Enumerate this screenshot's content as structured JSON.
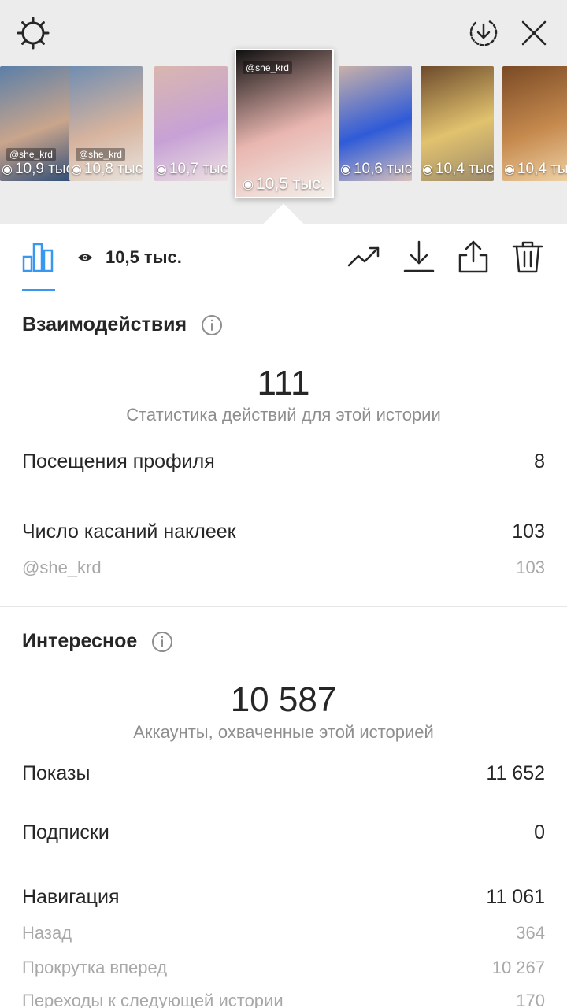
{
  "top_bar": {
    "settings_icon": "gear-icon",
    "download_all_icon": "download-circle-icon",
    "close_icon": "close-icon"
  },
  "thumbnails": [
    {
      "views": "10,9 тыс",
      "handle": "@she_krd",
      "colors": [
        "#5b7fa8",
        "#c9a58c",
        "#2f4d77"
      ]
    },
    {
      "views": "10,8 тыс",
      "handle": "@she_krd",
      "colors": [
        "#6f8db2",
        "#d6b39e",
        "#e9e4de"
      ]
    },
    {
      "views": "10,7 тыс",
      "handle": "",
      "colors": [
        "#d9b7ae",
        "#c7a1d6",
        "#ece2e0"
      ]
    },
    {
      "views": "10,5 тыс.",
      "handle": "@she_krd",
      "colors": [
        "#111111",
        "#e9b6b0",
        "#f2efea"
      ],
      "selected": true
    },
    {
      "views": "10,6 тыс",
      "handle": "",
      "colors": [
        "#c9b1a8",
        "#2f5bd8",
        "#d8c1bb"
      ]
    },
    {
      "views": "10,4 тыс",
      "handle": "",
      "colors": [
        "#6d4a2c",
        "#e1c26e",
        "#9c8a6c"
      ]
    },
    {
      "views": "10,4 тыс",
      "handle": "",
      "colors": [
        "#7a4a25",
        "#c68a4e",
        "#f0d4a8"
      ]
    }
  ],
  "toolbar": {
    "chart_tab_icon": "bar-chart-icon",
    "views_label": "10,5 тыс.",
    "trend_icon": "trend-up-icon",
    "download_icon": "download-icon",
    "share_icon": "share-icon",
    "delete_icon": "trash-icon"
  },
  "interactions": {
    "title": "Взаимодействия",
    "total": "111",
    "caption": "Статистика действий для этой истории",
    "rows": [
      {
        "label": "Посещения профиля",
        "value": "8"
      },
      {
        "label": "Число касаний наклеек",
        "value": "103"
      },
      {
        "label": "@she_krd",
        "value": "103"
      }
    ]
  },
  "discovery": {
    "title": "Интересное",
    "total": "10 587",
    "caption": "Аккаунты, охваченные этой историей",
    "rows": [
      {
        "label": "Показы",
        "value": "11 652"
      },
      {
        "label": "Подписки",
        "value": "0"
      },
      {
        "label": "Навигация",
        "value": "11 061"
      },
      {
        "label": "Назад",
        "value": "364"
      },
      {
        "label": "Прокрутка вперед",
        "value": "10 267"
      },
      {
        "label": "Переходы к следующей истории",
        "value": "170"
      }
    ]
  },
  "colors": {
    "accent": "#3897f0",
    "text": "#262626",
    "muted": "#8e8e8e",
    "top_bg": "#ececec"
  }
}
